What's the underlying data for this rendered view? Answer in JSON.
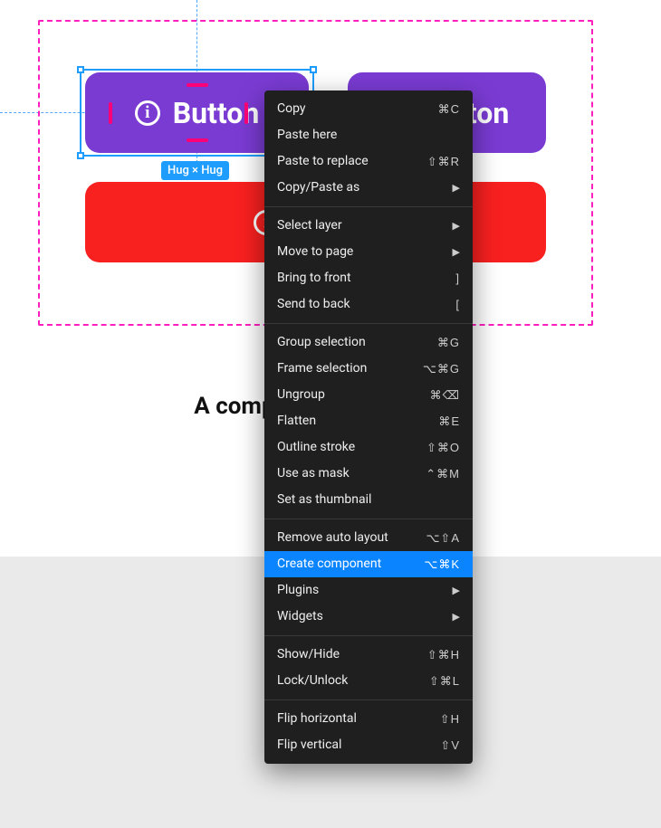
{
  "colors": {
    "purple": "#7a3bd3",
    "red": "#f92020",
    "selection": "#1f9dff",
    "frame": "#ff1fbf",
    "menu_highlight": "#0a84ff"
  },
  "canvas": {
    "button_label": "Button",
    "caption": "A component, specifically",
    "size_badge": "Hug × Hug"
  },
  "context_menu": {
    "highlighted_index": 16,
    "groups": [
      [
        {
          "label": "Copy",
          "shortcut": "⌘C"
        },
        {
          "label": "Paste here",
          "shortcut": ""
        },
        {
          "label": "Paste to replace",
          "shortcut": "⇧⌘R"
        },
        {
          "label": "Copy/Paste as",
          "submenu": true
        }
      ],
      [
        {
          "label": "Select layer",
          "submenu": true
        },
        {
          "label": "Move to page",
          "submenu": true
        },
        {
          "label": "Bring to front",
          "shortcut": "]"
        },
        {
          "label": "Send to back",
          "shortcut": "["
        }
      ],
      [
        {
          "label": "Group selection",
          "shortcut": "⌘G"
        },
        {
          "label": "Frame selection",
          "shortcut": "⌥⌘G"
        },
        {
          "label": "Ungroup",
          "shortcut": "⌘⌫"
        },
        {
          "label": "Flatten",
          "shortcut": "⌘E"
        },
        {
          "label": "Outline stroke",
          "shortcut": "⇧⌘O"
        },
        {
          "label": "Use as mask",
          "shortcut": "⌃⌘M"
        },
        {
          "label": "Set as thumbnail",
          "shortcut": ""
        }
      ],
      [
        {
          "label": "Remove auto layout",
          "shortcut": "⌥⇧A"
        },
        {
          "label": "Create component",
          "shortcut": "⌥⌘K"
        },
        {
          "label": "Plugins",
          "submenu": true
        },
        {
          "label": "Widgets",
          "submenu": true
        }
      ],
      [
        {
          "label": "Show/Hide",
          "shortcut": "⇧⌘H"
        },
        {
          "label": "Lock/Unlock",
          "shortcut": "⇧⌘L"
        }
      ],
      [
        {
          "label": "Flip horizontal",
          "shortcut": "⇧H"
        },
        {
          "label": "Flip vertical",
          "shortcut": "⇧V"
        }
      ]
    ]
  }
}
